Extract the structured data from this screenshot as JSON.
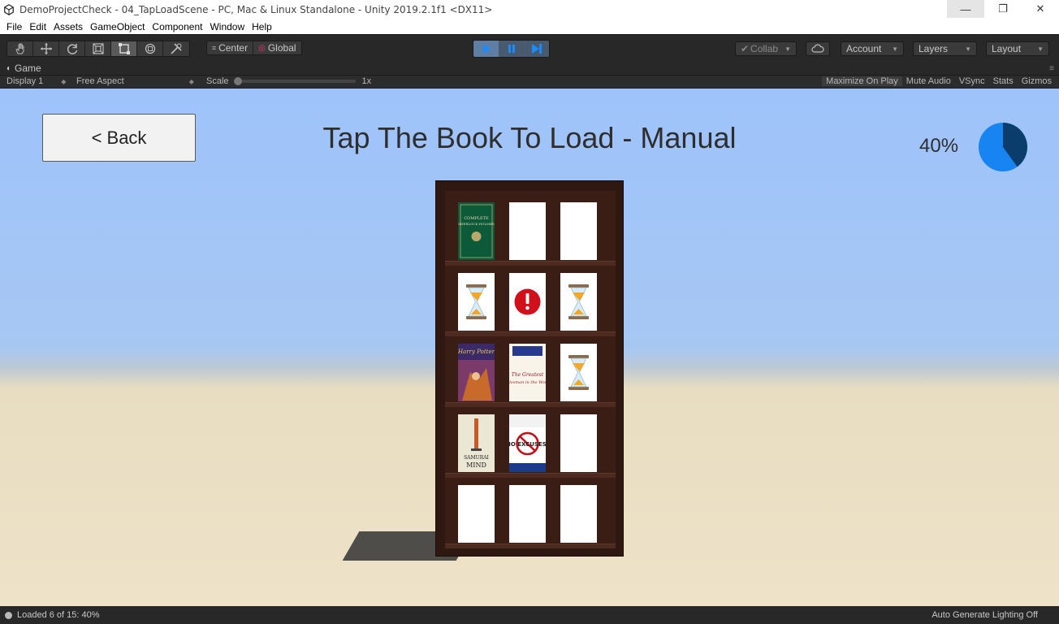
{
  "window": {
    "title": "DemoProjectCheck - 04_TapLoadScene - PC, Mac & Linux Standalone - Unity 2019.2.1f1 <DX11>",
    "minimize": "—",
    "restore": "❐",
    "close": "✕"
  },
  "menu": [
    "File",
    "Edit",
    "Assets",
    "GameObject",
    "Component",
    "Window",
    "Help"
  ],
  "toolbar": {
    "tools": [
      "hand-tool",
      "move-tool",
      "rotate-tool",
      "scale-tool",
      "rect-tool",
      "transform-tool",
      "custom-tool"
    ],
    "active_tool": "rect-tool",
    "pivot_center": "Center",
    "pivot_global": "Global",
    "collab": "Collab",
    "account": "Account",
    "layers": "Layers",
    "layout": "Layout"
  },
  "game_tab": {
    "label": "Game",
    "display": "Display 1",
    "aspect": "Free Aspect",
    "scale_label": "Scale",
    "scale_value": "1x",
    "maximize_on_play": "Maximize On Play",
    "mute_audio": "Mute Audio",
    "vsync": "VSync",
    "stats": "Stats",
    "gizmos": "Gizmos"
  },
  "scene": {
    "back_label": "< Back",
    "title": "Tap The Book To Load - Manual",
    "progress_text": "40%",
    "progress_fraction": 0.4,
    "colors": {
      "sky": "#9ec3fb",
      "floor": "#eee2c8",
      "pie_filled": "#0a3d6b",
      "pie_remaining": "#1784f2",
      "shelf": "#2f1712"
    },
    "shelf_slots": [
      {
        "state": "book",
        "title": "COMPLETE SHERLOCK HOLMES"
      },
      {
        "state": "empty"
      },
      {
        "state": "empty"
      },
      {
        "state": "loading"
      },
      {
        "state": "error"
      },
      {
        "state": "loading"
      },
      {
        "state": "book",
        "title": "Harry Potter"
      },
      {
        "state": "book",
        "title": "The Greatest Salesman in the World"
      },
      {
        "state": "loading"
      },
      {
        "state": "book",
        "title": "SAMURAI MIND"
      },
      {
        "state": "book",
        "title": "NO EXCUSES!"
      },
      {
        "state": "empty"
      },
      {
        "state": "empty"
      },
      {
        "state": "empty"
      },
      {
        "state": "empty"
      }
    ]
  },
  "status": {
    "message": "Loaded 6 of 15: 40%",
    "right": "Auto Generate Lighting Off"
  }
}
